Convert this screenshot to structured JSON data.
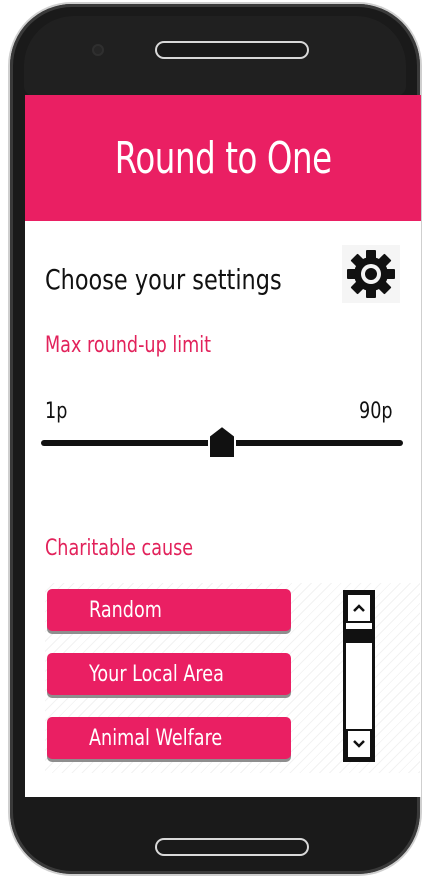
{
  "header": {
    "title": "Round to One"
  },
  "settings": {
    "title": "Choose your settings",
    "icon": "gear-icon"
  },
  "round_up": {
    "label": "Max round-up limit",
    "min_label": "1p",
    "max_label": "90p",
    "value_fraction": 0.5
  },
  "cause": {
    "label": "Charitable cause",
    "options": [
      {
        "label": "Random"
      },
      {
        "label": "Your Local Area"
      },
      {
        "label": "Animal Welfare"
      }
    ]
  },
  "colors": {
    "accent": "#ea1f63",
    "text": "#111111",
    "device": "#1a1a1a"
  }
}
